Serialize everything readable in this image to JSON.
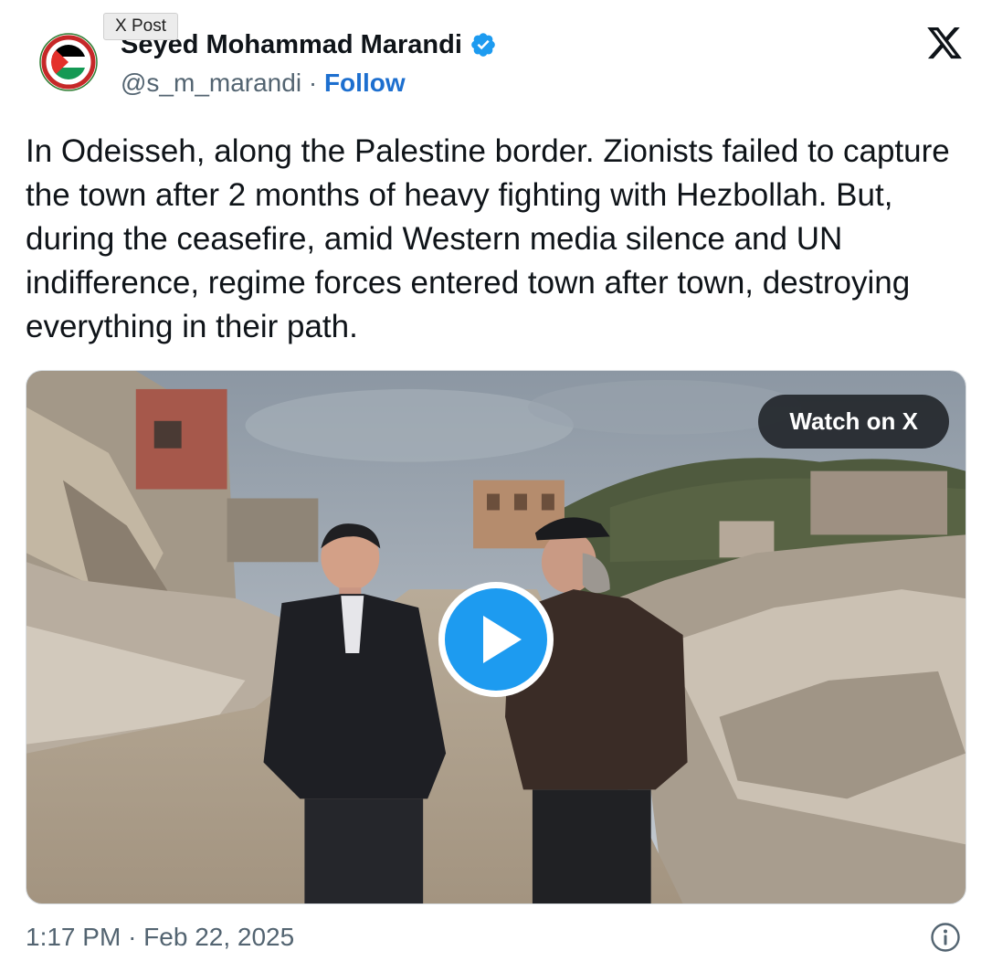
{
  "tooltip": "X Post",
  "author": {
    "name": "Seyed Mohammad Marandi",
    "handle": "@s_m_marandi",
    "separator": "·",
    "follow_label": "Follow",
    "avatar_icon": "save-gaza-palestine-flag-badge-icon",
    "verified_icon": "verified-badge-icon"
  },
  "tweet": {
    "text": "In Odeisseh, along the Palestine border. Zionists failed to capture the town after 2 months of heavy fighting with Hezbollah. But, during the ceasefire, amid Western media silence and UN indifference, regime forces entered town after town, destroying everything in their path."
  },
  "media": {
    "watch_label": "Watch on X",
    "play_icon": "play-icon"
  },
  "footer": {
    "time": "1:17 PM",
    "separator": "·",
    "date": "Feb 22, 2025",
    "info_icon": "info-icon"
  },
  "colors": {
    "link": "#1d6fcf",
    "verified": "#1d9bf0",
    "secondary_text": "#536471",
    "play": "#1d9bf0"
  }
}
